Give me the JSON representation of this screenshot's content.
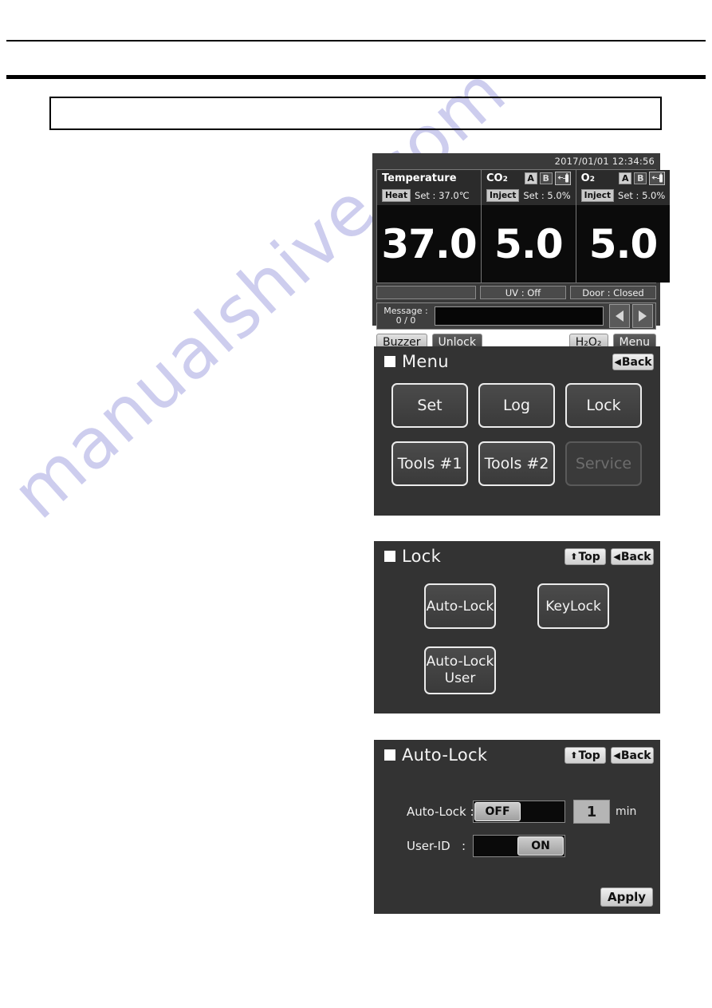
{
  "document": {
    "title_box_text": ""
  },
  "watermark": {
    "text": "manualshive.com"
  },
  "status_screen": {
    "datetime": "2017/01/01  12:34:56",
    "columns": [
      {
        "name": "Temperature",
        "name_sub": "",
        "mode": "Heat",
        "set_label": "Set : 37.0℃",
        "value": "37.0",
        "has_ab": false
      },
      {
        "name": "CO",
        "name_sub": "2",
        "mode": "Inject",
        "set_label": "Set :  5.0%",
        "value": "5.0",
        "has_ab": true,
        "ab": {
          "a": "A",
          "b": "B",
          "active": "A"
        },
        "cylinder_icon": "gas-cylinder-switch-icon"
      },
      {
        "name": "O",
        "name_sub": "2",
        "mode": "Inject",
        "set_label": "Set :  5.0%",
        "value": "5.0",
        "has_ab": true,
        "ab": {
          "a": "A",
          "b": "B",
          "active": "A"
        },
        "cylinder_icon": "gas-cylinder-switch-icon"
      }
    ],
    "status_cells": [
      "",
      "UV : Off",
      "Door : Closed"
    ],
    "message": {
      "label": "Message :",
      "count": "0 / 0",
      "value": ""
    },
    "buttons": {
      "buzzer": "Buzzer",
      "unlock": "Unlock",
      "h2o2": "H₂O₂",
      "menu": "Menu"
    }
  },
  "menu_screen": {
    "title": "Menu",
    "nav": {
      "back": "Back"
    },
    "items": [
      {
        "label": "Set",
        "disabled": false
      },
      {
        "label": "Log",
        "disabled": false
      },
      {
        "label": "Lock",
        "disabled": false
      },
      {
        "label": "Tools #1",
        "disabled": false
      },
      {
        "label": "Tools #2",
        "disabled": false
      },
      {
        "label": "Service",
        "disabled": true
      }
    ]
  },
  "lock_screen": {
    "title": "Lock",
    "nav": {
      "top": "Top",
      "back": "Back"
    },
    "items": [
      {
        "label": "Auto-Lock"
      },
      {
        "label": "KeyLock"
      },
      {
        "label": "Auto-Lock\nUser",
        "line1": "Auto-Lock",
        "line2": "User"
      }
    ]
  },
  "autolock_screen": {
    "title": "Auto-Lock",
    "nav": {
      "top": "Top",
      "back": "Back"
    },
    "fields": [
      {
        "label": "Auto-Lock :",
        "toggle_value": "OFF",
        "toggle_side": "left"
      },
      {
        "label": "User-ID",
        "separator": ":",
        "toggle_value": "ON",
        "toggle_side": "right"
      }
    ],
    "minutes": {
      "value": "1",
      "unit": "min"
    },
    "apply_label": "Apply"
  }
}
